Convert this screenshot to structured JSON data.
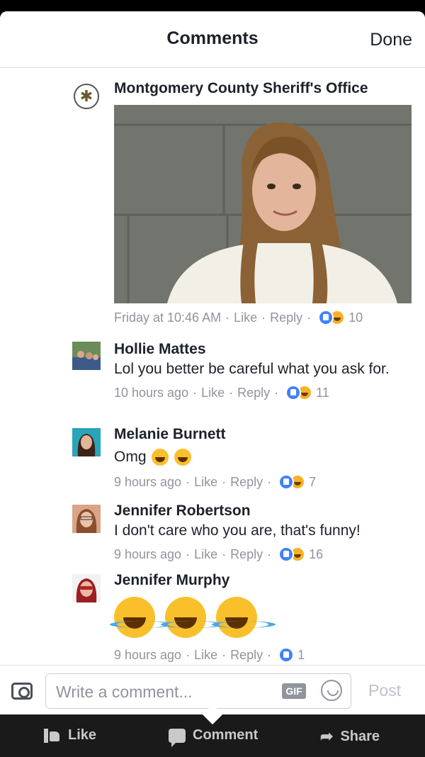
{
  "header": {
    "title": "Comments",
    "done_label": "Done"
  },
  "post": {
    "author": "Montgomery County Sheriff's Office",
    "time": "Friday at 10:46 AM",
    "like_label": "Like",
    "reply_label": "Reply",
    "reaction_count": "10"
  },
  "comments": [
    {
      "author": "Hollie Mattes",
      "text": "Lol you better be careful what you ask for.",
      "time": "10 hours ago",
      "like_label": "Like",
      "reply_label": "Reply",
      "reaction_count": "11"
    },
    {
      "author": "Melanie Burnett",
      "text": "Omg",
      "time": "9 hours ago",
      "like_label": "Like",
      "reply_label": "Reply",
      "reaction_count": "7"
    },
    {
      "author": "Jennifer Robertson",
      "text": "I don't care who you are,  that's funny!",
      "time": "9 hours ago",
      "like_label": "Like",
      "reply_label": "Reply",
      "reaction_count": "16"
    },
    {
      "author": "Jennifer Murphy",
      "text": "",
      "time": "9 hours ago",
      "like_label": "Like",
      "reply_label": "Reply",
      "reaction_count": "1"
    }
  ],
  "composer": {
    "placeholder": "Write a comment...",
    "gif_label": "GIF",
    "post_label": "Post"
  },
  "bottom_bar": {
    "like_label": "Like",
    "comment_label": "Comment",
    "share_label": "Share"
  },
  "colors": {
    "like_blue": "#4080ff",
    "haha_yellow": "#f7b125",
    "meta_gray": "#90949c"
  }
}
